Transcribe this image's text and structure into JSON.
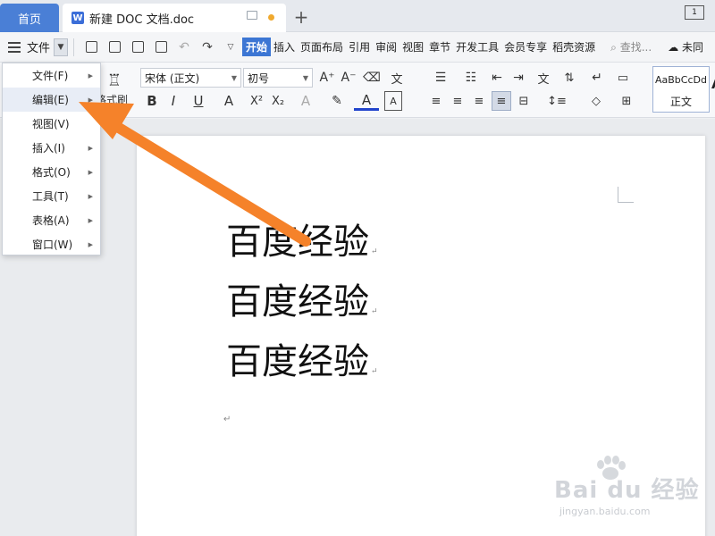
{
  "titlebar": {
    "home_tab": "首页",
    "doc_tab": "新建 DOC 文档.doc",
    "doc_icon_letter": "W",
    "add_tab": "+",
    "window_btn": "1"
  },
  "menubar": {
    "file_label": "文件",
    "ribbon_tabs": [
      "开始",
      "插入",
      "页面布局",
      "引用",
      "审阅",
      "视图",
      "章节",
      "开发工具",
      "会员专享",
      "稻壳资源"
    ],
    "search_placeholder": "查找...",
    "cloud_label": "未同"
  },
  "ribbon": {
    "format_painter": "格式刷",
    "font_name": "宋体 (正文)",
    "font_size": "初号",
    "style_preview": "AaBbCcDd",
    "style_name": "正文",
    "style_next": "A"
  },
  "menu": {
    "items": [
      {
        "label": "文件(F)"
      },
      {
        "label": "编辑(E)"
      },
      {
        "label": "视图(V)"
      },
      {
        "label": "插入(I)"
      },
      {
        "label": "格式(O)"
      },
      {
        "label": "工具(T)"
      },
      {
        "label": "表格(A)"
      },
      {
        "label": "窗口(W)"
      }
    ],
    "highlighted_index": 1
  },
  "document": {
    "lines": [
      "百度经验",
      "百度经验",
      "百度经验"
    ],
    "paragraph_mark": "↵"
  },
  "watermark": {
    "main": "Bai du 经验",
    "sub": "jingyan.baidu.com"
  },
  "colors": {
    "accent": "#3c76d4",
    "arrow": "#f5822a",
    "tab_dot": "#f0a92e"
  }
}
